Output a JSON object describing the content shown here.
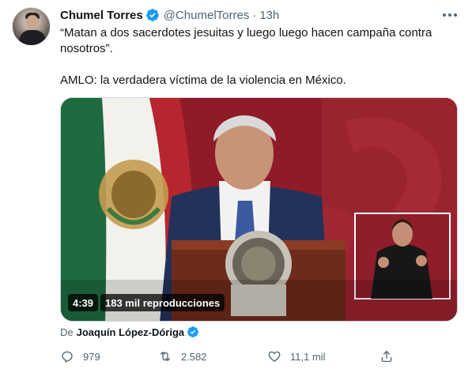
{
  "tweet": {
    "author": {
      "display_name": "Chumel Torres",
      "handle": "@ChumelTorres",
      "separator": "·",
      "time": "13h"
    },
    "text_line_1": "“Matan a dos sacerdotes jesuitas y luego luego hacen campaña contra nosotros”.",
    "text_line_2": "AMLO: la verdadera víctima de la violencia en México.",
    "media": {
      "duration": "4:39",
      "views": "183 mil reproducciones"
    },
    "source": {
      "prefix": "De",
      "author": "Joaquín López-Dóriga"
    },
    "actions": {
      "reply_count": "979",
      "retweet_count": "2.582",
      "like_count": "11,1 mil"
    }
  },
  "colors": {
    "verified_blue": "#1d9bf0",
    "secondary_text": "#536471",
    "primary_text": "#0f1419",
    "video_backdrop": "#8c1a25"
  },
  "icons": {
    "verified": "verified-badge-icon",
    "more": "more-dots-icon",
    "reply": "reply-icon",
    "retweet": "retweet-icon",
    "like": "heart-icon",
    "share": "share-icon"
  }
}
